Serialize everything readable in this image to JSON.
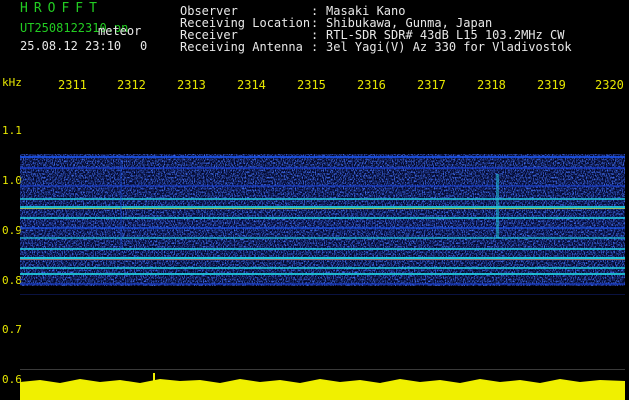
{
  "header": {
    "app_title": "HROFFT",
    "file_name": "UT2508122310.pn",
    "file_tag": "meteor",
    "date_time": "25.08.12 23:10",
    "counter": "0"
  },
  "info": [
    {
      "label": "Observer",
      "value": "Masaki Kano"
    },
    {
      "label": "Receiving Location",
      "value": "Shibukawa, Gunma, Japan"
    },
    {
      "label": "Receiver",
      "value": "RTL-SDR SDR# 43dB L15 103.2MHz CW"
    },
    {
      "label": "Receiving Antenna",
      "value": "3el Yagi(V) Az 330 for Vladivostok"
    }
  ],
  "axis": {
    "unit_label": "kHz",
    "y_ticks": [
      "1.1",
      "1.0",
      "0.9",
      "0.8",
      "0.7",
      "0.6"
    ],
    "x_ticks": [
      "2311",
      "2312",
      "2313",
      "2314",
      "2315",
      "2316",
      "2317",
      "2318",
      "2319",
      "2320"
    ]
  },
  "colors": {
    "background": "#000000",
    "header_green": "#22cc22",
    "info_white": "#e8e8e8",
    "axis_yellow": "#e6e600",
    "noise_blue": "#1a2cc8",
    "band_cyan": "#20d0e0",
    "band_red": "#e02a20",
    "level_yellow": "#f0f000"
  }
}
